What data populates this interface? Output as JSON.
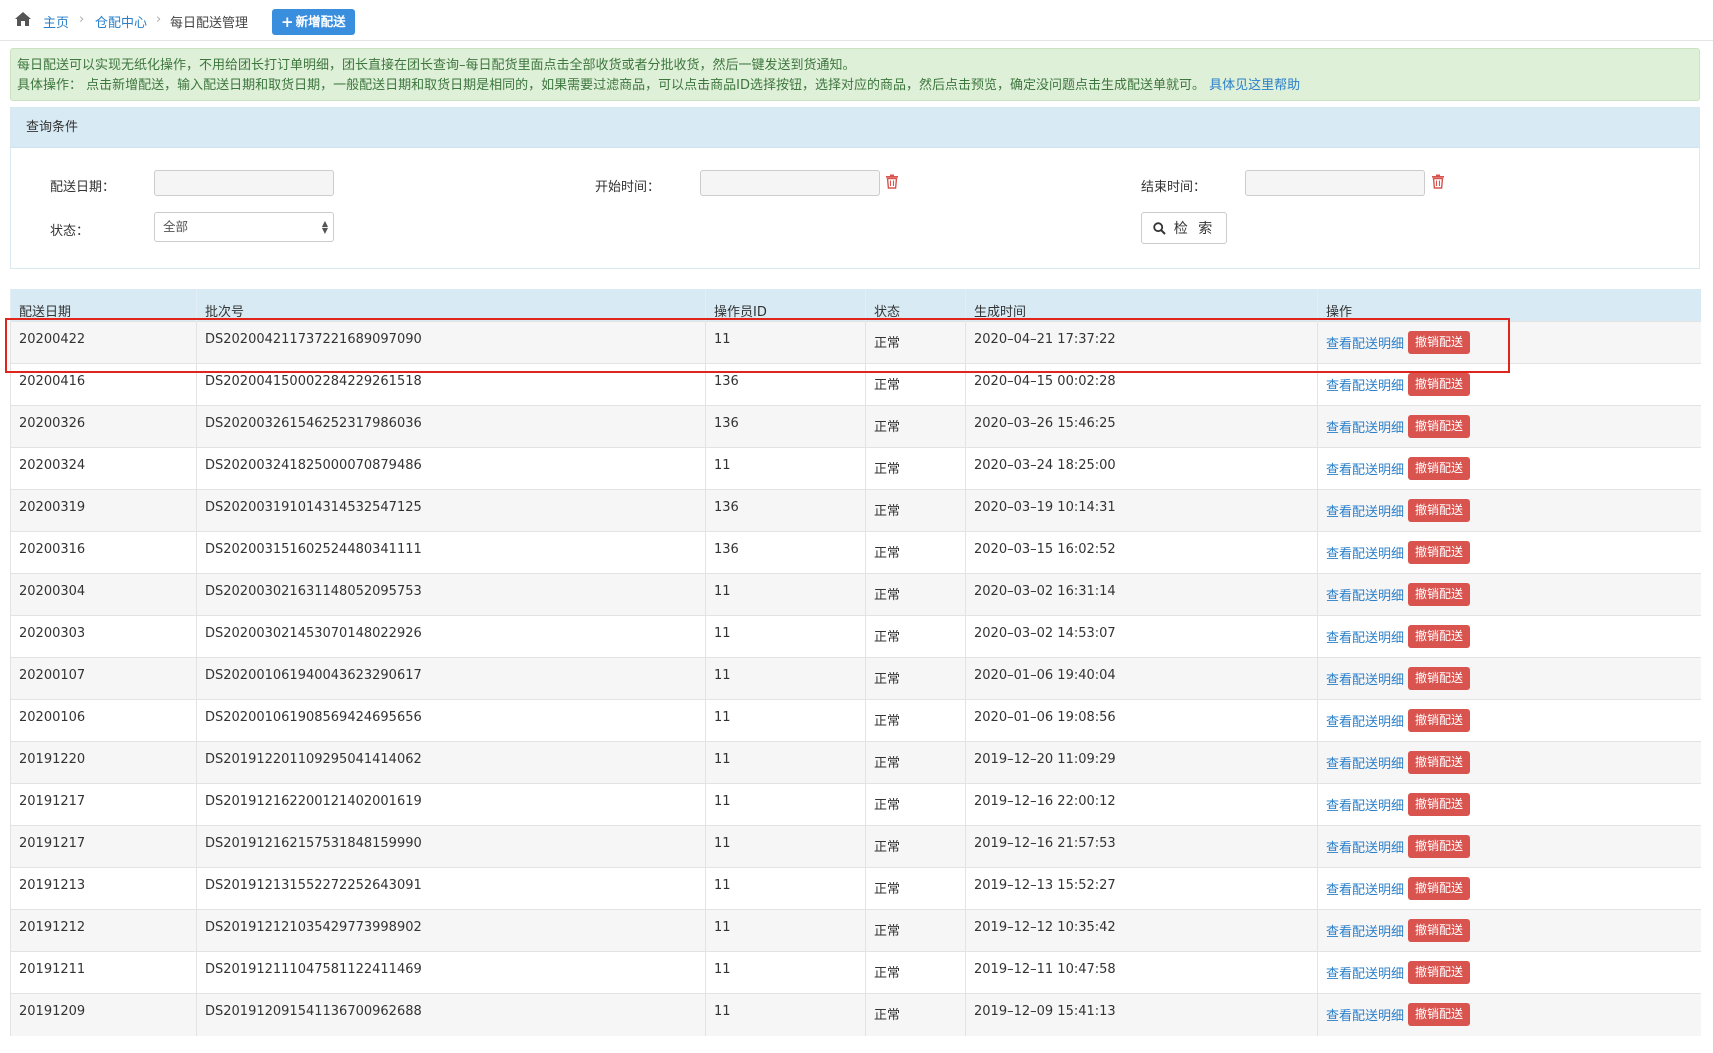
{
  "breadcrumb": {
    "home": "主页",
    "parent": "仓配中心",
    "current": "每日配送管理",
    "separator": "›"
  },
  "toolbar": {
    "add_label": "新增配送"
  },
  "notice": {
    "line1": "每日配送可以实现无纸化操作，不用给团长打订单明细，团长直接在团长查询–每日配货里面点击全部收货或者分批收货，然后一键发送到货通知。",
    "line2_prefix": "具体操作：  点击新增配送，输入配送日期和取货日期，一般配送日期和取货日期是相同的，如果需要过滤商品，可以点击商品ID选择按钮，选择对应的商品，然后点击预览，确定没问题点击生成配送单就可。",
    "help_link": "具体见这里帮助"
  },
  "query": {
    "title": "查询条件",
    "delivery_date_label": "配送日期：",
    "delivery_date_value": "",
    "start_time_label": "开始时间：",
    "start_time_value": "",
    "end_time_label": "结束时间：",
    "end_time_value": "",
    "status_label": "状态：",
    "status_value": "全部",
    "search_label": "检 索"
  },
  "table": {
    "headers": [
      "配送日期",
      "批次号",
      "操作员ID",
      "状态",
      "生成时间",
      "操作"
    ],
    "view_label": "查看配送明细",
    "revoke_label": "撤销配送",
    "rows": [
      [
        "20200422",
        "DS20200421173722168​9097090",
        "11",
        "正常",
        "2020–04–21 17:37:22"
      ],
      [
        "20200416",
        "DS20200415000228422926​1518",
        "136",
        "正常",
        "2020–04–15 00:02:28"
      ],
      [
        "20200326",
        "DS2020032615462523179860​36",
        "136",
        "正常",
        "2020–03–26 15:46:25"
      ],
      [
        "20200324",
        "DS20200324182500007087​9486",
        "11",
        "正常",
        "2020–03–24 18:25:00"
      ],
      [
        "20200319",
        "DS20200319101431453254712​5",
        "136",
        "正常",
        "2020–03–19 10:14:31"
      ],
      [
        "20200316",
        "DS20200315160252448034​1111",
        "136",
        "正常",
        "2020–03–15 16:02:52"
      ],
      [
        "20200304",
        "DS20200302163114805209​5753",
        "11",
        "正常",
        "2020–03–02 16:31:14"
      ],
      [
        "20200303",
        "DS20200302145307014802​2926",
        "11",
        "正常",
        "2020–03–02 14:53:07"
      ],
      [
        "20200107",
        "DS20200106194004362329​0617",
        "11",
        "正常",
        "2020–01–06 19:40:04"
      ],
      [
        "20200106",
        "DS20200106190856942469​5656",
        "11",
        "正常",
        "2020–01–06 19:08:56"
      ],
      [
        "20191220",
        "DS20191220110929504141​4062",
        "11",
        "正常",
        "2019–12–20 11:09:29"
      ],
      [
        "20191217",
        "DS20191216220012140200​1619",
        "11",
        "正常",
        "2019–12–16 22:00:12"
      ],
      [
        "20191217",
        "DS20191216215753184815​9990",
        "11",
        "正常",
        "2019–12–16 21:57:53"
      ],
      [
        "20191213",
        "DS20191213155227225264​3091",
        "11",
        "正常",
        "2019–12–13 15:52:27"
      ],
      [
        "20191212",
        "DS20191212103542977399​8902",
        "11",
        "正常",
        "2019–12–12 10:35:42"
      ],
      [
        "20191211",
        "DS2019121110475811224114​69",
        "11",
        "正常",
        "2019–12–11 10:47:58"
      ],
      [
        "20191209",
        "DS20191209154113670096​2688",
        "11",
        "正常",
        "2019–12–09 15:41:13"
      ]
    ]
  },
  "colors": {
    "link": "#2a7fc9",
    "primary_button": "#3a8ede",
    "danger_button": "#d9534f",
    "notice_bg": "#dff0d8",
    "notice_text": "#3c763d",
    "header_bg": "#d8ebf5",
    "highlight": "#e0261c"
  }
}
